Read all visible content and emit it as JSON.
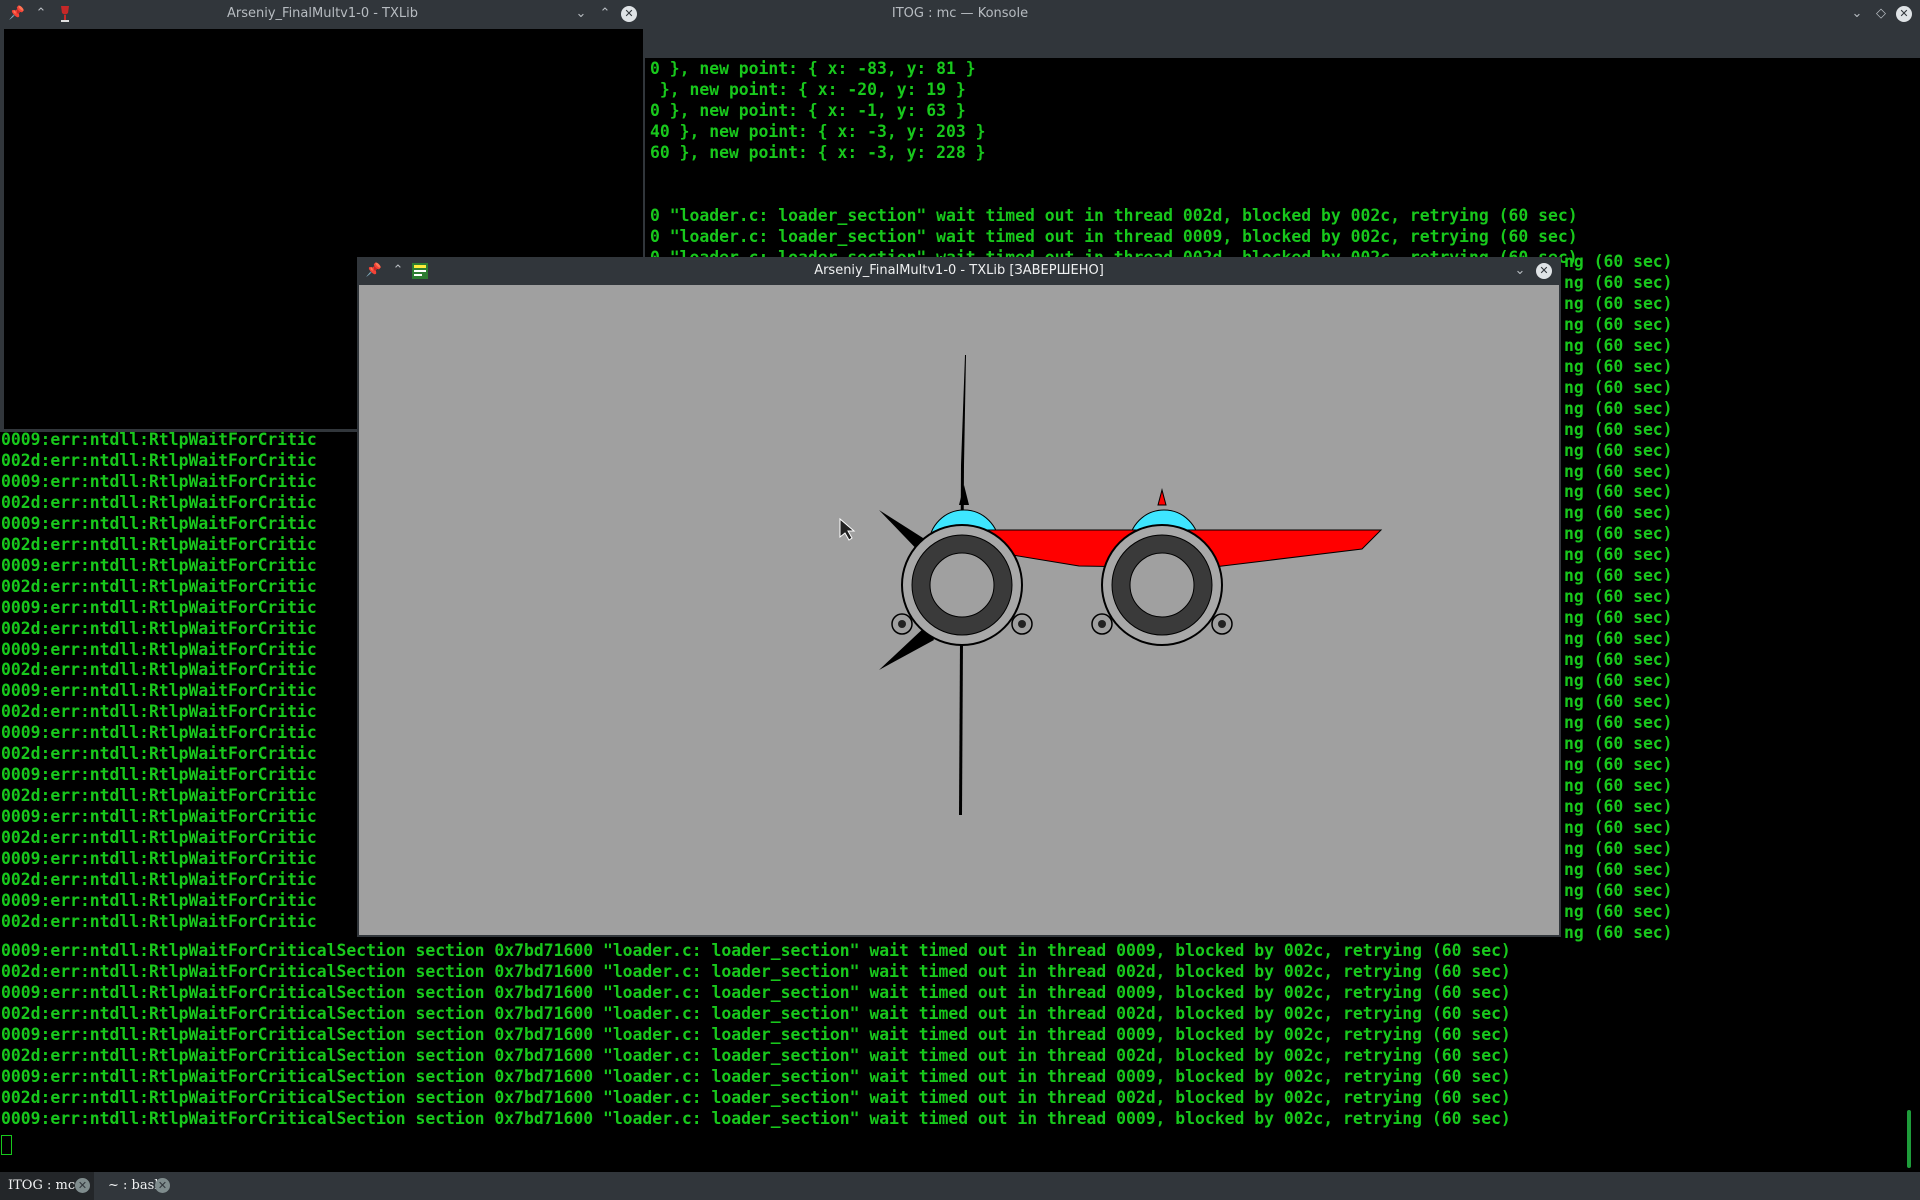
{
  "konsole": {
    "title": "ITOG : mc — Konsole",
    "upper_lines": [
      "0 }, new point: { x: -83, y: 81 }",
      " }, new point: { x: -20, y: 19 }",
      "0 }, new point: { x: -1, y: 63 }",
      "40 }, new point: { x: -3, y: 203 }",
      "60 }, new point: { x: -3, y: 228 }",
      "",
      "",
      "0 \"loader.c: loader_section\" wait timed out in thread 002d, blocked by 002c, retrying (60 sec)",
      "0 \"loader.c: loader_section\" wait timed out in thread 0009, blocked by 002c, retrying (60 sec)",
      "0 \"loader.c: loader_section\" wait timed out in thread 002d, blocked by 002c, retrying (60 sec)"
    ],
    "lower_lines_text": "0009:err:ntdll:RtlpWaitForCritic\n0002d:err:ntdll:RtlpWaitForCritic",
    "bottom_lines": [
      "0009:err:ntdll:RtlpWaitForCriticalSection section 0x7bd71600 \"loader.c: loader_section\" wait timed out in thread 0009, blocked by 002c, retrying (60 sec)",
      "002d:err:ntdll:RtlpWaitForCriticalSection section 0x7bd71600 \"loader.c: loader_section\" wait timed out in thread 002d, blocked by 002c, retrying (60 sec)",
      "0009:err:ntdll:RtlpWaitForCriticalSection section 0x7bd71600 \"loader.c: loader_section\" wait timed out in thread 0009, blocked by 002c, retrying (60 sec)",
      "002d:err:ntdll:RtlpWaitForCriticalSection section 0x7bd71600 \"loader.c: loader_section\" wait timed out in thread 002d, blocked by 002c, retrying (60 sec)",
      "0009:err:ntdll:RtlpWaitForCriticalSection section 0x7bd71600 \"loader.c: loader_section\" wait timed out in thread 0009, blocked by 002c, retrying (60 sec)",
      "002d:err:ntdll:RtlpWaitForCriticalSection section 0x7bd71600 \"loader.c: loader_section\" wait timed out in thread 002d, blocked by 002c, retrying (60 sec)",
      "0009:err:ntdll:RtlpWaitForCriticalSection section 0x7bd71600 \"loader.c: loader_section\" wait timed out in thread 0009, blocked by 002c, retrying (60 sec)",
      "002d:err:ntdll:RtlpWaitForCriticalSection section 0x7bd71600 \"loader.c: loader_section\" wait timed out in thread 002d, blocked by 002c, retrying (60 sec)",
      "0009:err:ntdll:RtlpWaitForCriticalSection section 0x7bd71600 \"loader.c: loader_section\" wait timed out in thread 0009, blocked by 002c, retrying (60 sec)"
    ],
    "right_fragment": "ng (60 sec)",
    "tabs": [
      {
        "label": "ITOG : mc"
      },
      {
        "label": "~ : bash"
      }
    ]
  },
  "txlib_small": {
    "title": "Arseniy_FinalMultv1-0 - TXLib"
  },
  "txlib_large": {
    "title": "Arseniy_FinalMultv1-0 - TXLib [ЗАВЕРШЕНО]",
    "canvas_color": "#a0a0a0"
  },
  "colors": {
    "terminal_green": "#18c81c",
    "titlebar": "#31363b",
    "plane_red": "#ff0000",
    "cockpit_cyan": "#3ee6ff"
  },
  "icons": [
    "pin-icon",
    "keep-above-icon",
    "txlib-app-icon",
    "minimize-icon",
    "maximize-icon",
    "close-icon",
    "tab-close-icon"
  ]
}
